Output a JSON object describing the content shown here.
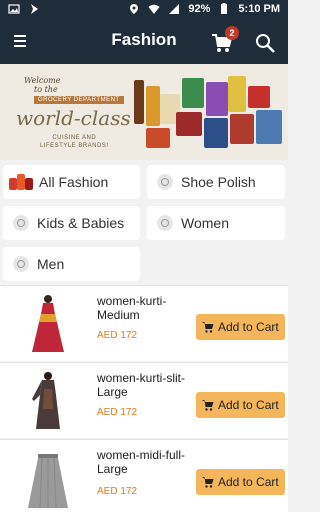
{
  "status_bar": {
    "battery": "92%",
    "time": "5:10 PM"
  },
  "app_bar": {
    "title": "Fashion",
    "cart_count": "2",
    "icons": [
      "menu-icon",
      "cart-icon",
      "search-icon"
    ]
  },
  "banner": {
    "welcome_line1": "Welcome",
    "welcome_line2": "to the",
    "department": "GROCERY DEPARTMENT",
    "headline": "world-class",
    "subline1": "CUISINE AND",
    "subline2": "LIFESTYLE BRANDS!"
  },
  "categories": [
    {
      "label": "All Fashion",
      "icon": "fashion-icon"
    },
    {
      "label": "Shoe Polish",
      "icon": "category-icon"
    },
    {
      "label": "Kids & Babies",
      "icon": "category-icon"
    },
    {
      "label": "Women",
      "icon": "category-icon"
    },
    {
      "label": "Men",
      "icon": "category-icon"
    }
  ],
  "products": [
    {
      "name": "women-kurti-Medium",
      "price": "AED 172",
      "button": "Add to Cart"
    },
    {
      "name": "women-kurti-slit-Large",
      "price": "AED 172",
      "button": "Add to Cart"
    },
    {
      "name": "women-midi-full-Large",
      "price": "AED 172",
      "button": "Add to Cart"
    }
  ],
  "colors": {
    "app_bar": "#1f2d3a",
    "price": "#e07b1a",
    "add_button": "#f4b65a",
    "badge": "#c0392b"
  }
}
